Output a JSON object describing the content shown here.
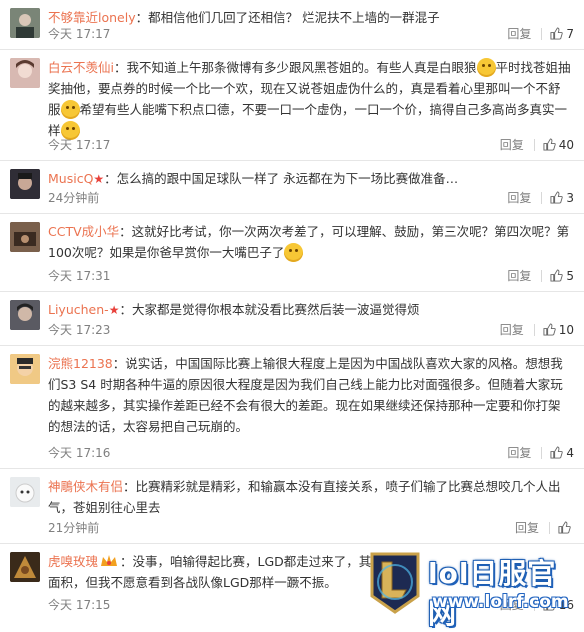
{
  "comments": [
    {
      "username": "不够靠近lonely",
      "text": "：都相信他们几回了还相信？ 烂泥扶不上墙的一群混子",
      "time": "今天 17:17",
      "reply_label": "回复",
      "likes": "7",
      "avatar_color": "#6b7568"
    },
    {
      "username": "白云不羡仙i",
      "text_1": "：我不知道上午那条微博有多少跟风黑苍姐的。有些人真是白眼狼",
      "text_2": "平时找苍姐抽奖抽他，要点券的时候一个比一个欢，现在又说苍姐虚伪什么的，真是看着心里那叫一个不舒服",
      "text_3": "希望有些人能嘴下积点口德，不要一口一个虚伪，一口一个价，搞得自己多高尚多真实一样",
      "time": "今天 17:17",
      "reply_label": "回复",
      "likes": "40",
      "avatar_color": "#c9a7a0"
    },
    {
      "username": "MusicQ",
      "badge": "★",
      "text": "：怎么搞的跟中国足球队一样了 永远都在为下一场比赛做准备…",
      "time": "24分钟前",
      "reply_label": "回复",
      "likes": "3",
      "avatar_color": "#3c3a44"
    },
    {
      "username": "CCTV成小华",
      "text_1": "：这就好比考试，你一次两次考差了，可以理解、鼓励，第三次呢？第四次呢？第100次呢？如果是你爸早赏你一大嘴巴子了",
      "time": "今天 17:31",
      "reply_label": "回复",
      "likes": "5",
      "avatar_color": "#6a5242"
    },
    {
      "username": "Liyuchen-",
      "badge": "★",
      "text": "：大家都是觉得你根本就没看比赛然后装一波逼觉得烦",
      "time": "今天 17:23",
      "reply_label": "回复",
      "likes": "10",
      "avatar_color": "#4e4e56"
    },
    {
      "username": "浣熊12138",
      "text": "：说实话，中国国际比赛上输很大程度上是因为中国战队喜欢大家的风格。想想我们S3 S4 时期各种牛逼的原因很大程度是因为我们自己线上能力比对面强很多。但随着大家玩的越来越多，其实操作差距已经不会有很大的差距。现在如果继续还保持那种一定要和你打架的想法的话，太容易把自己玩崩的。",
      "time": "今天 17:16",
      "reply_label": "回复",
      "likes": "4",
      "avatar_color": "#e0b070"
    },
    {
      "username": "神鵰侠木有侣",
      "text": "：比赛精彩就是精彩，和输赢本没有直接关系，喷子们输了比赛总想咬几个人出气，苍姐别往心里去",
      "time": "21分钟前",
      "reply_label": "回复",
      "likes": "",
      "avatar_color": "#dfe2e4"
    },
    {
      "username": "虎嗅玫瑰",
      "text_1": "：没事，咱输得起比赛，LGD都走过来了，其他",
      "text_2": "面积，但我不愿意看到各战队像LGD那样一蹶不振。",
      "time": "今天 17:15",
      "reply_label": "回复",
      "likes": "16",
      "avatar_color": "#5a4530"
    }
  ],
  "watermark": {
    "title": "lol日服官网",
    "url": "www.lolrf.com"
  },
  "colors": {
    "username": "#eb7350",
    "meta": "#808080",
    "divider": "#e6e6e6"
  }
}
